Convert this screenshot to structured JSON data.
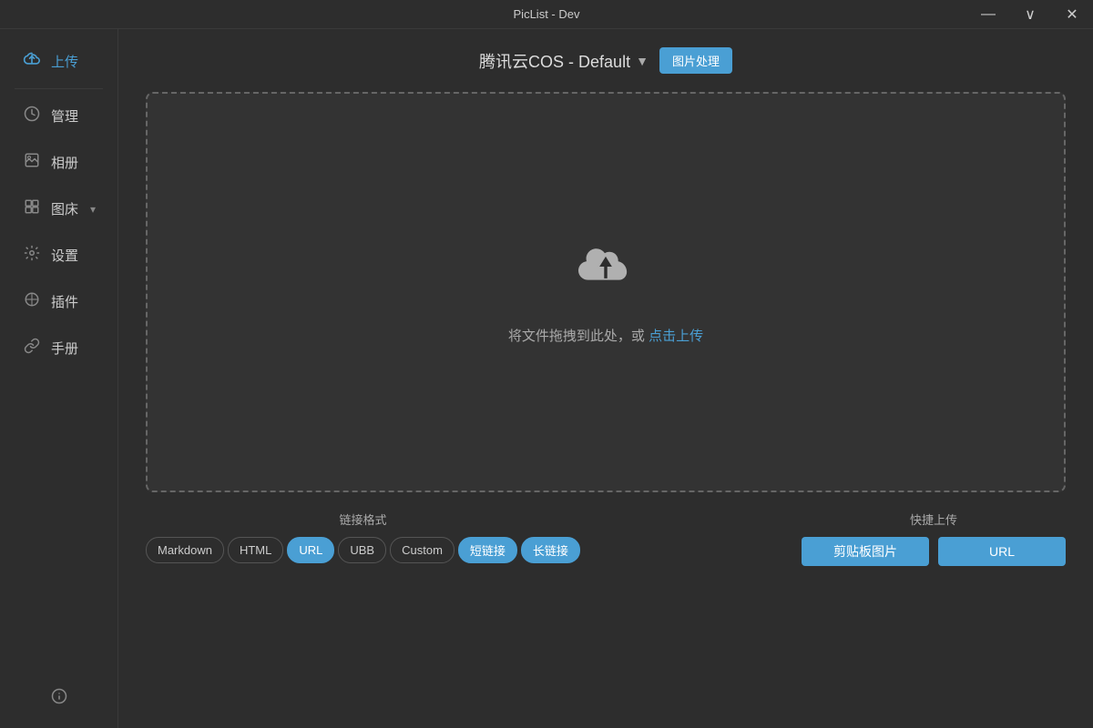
{
  "titlebar": {
    "title": "PicList - Dev",
    "controls": {
      "minimize": "—",
      "maximize": "∨",
      "close": "✕"
    }
  },
  "sidebar": {
    "items": [
      {
        "id": "upload",
        "label": "上传",
        "icon": "☁",
        "active": true
      },
      {
        "id": "manage",
        "label": "管理",
        "icon": "⏰",
        "active": false
      },
      {
        "id": "album",
        "label": "相册",
        "icon": "🖼",
        "active": false
      },
      {
        "id": "picbed",
        "label": "图床",
        "icon": "⊞",
        "active": false,
        "chevron": true
      },
      {
        "id": "settings",
        "label": "设置",
        "icon": "⚙",
        "active": false
      },
      {
        "id": "plugins",
        "label": "插件",
        "icon": "⬡",
        "active": false
      },
      {
        "id": "manual",
        "label": "手册",
        "icon": "🔗",
        "active": false
      }
    ],
    "info_icon": "ℹ"
  },
  "main": {
    "bucket_selector": {
      "label": "腾讯云COS - Default",
      "arrow": "▼"
    },
    "image_process_btn": "图片处理",
    "drop_zone": {
      "text_prefix": "将文件拖拽到此处，或 ",
      "text_link": "点击上传"
    },
    "link_format": {
      "label": "链接格式",
      "buttons": [
        {
          "id": "markdown",
          "label": "Markdown",
          "active": false
        },
        {
          "id": "html",
          "label": "HTML",
          "active": false
        },
        {
          "id": "url",
          "label": "URL",
          "active": true
        },
        {
          "id": "ubb",
          "label": "UBB",
          "active": false
        },
        {
          "id": "custom",
          "label": "Custom",
          "active": false
        },
        {
          "id": "short",
          "label": "短链接",
          "active": false
        },
        {
          "id": "long",
          "label": "长链接",
          "active": false
        }
      ]
    },
    "quick_upload": {
      "label": "快捷上传",
      "buttons": [
        {
          "id": "clipboard",
          "label": "剪贴板图片"
        },
        {
          "id": "url",
          "label": "URL"
        }
      ]
    }
  }
}
